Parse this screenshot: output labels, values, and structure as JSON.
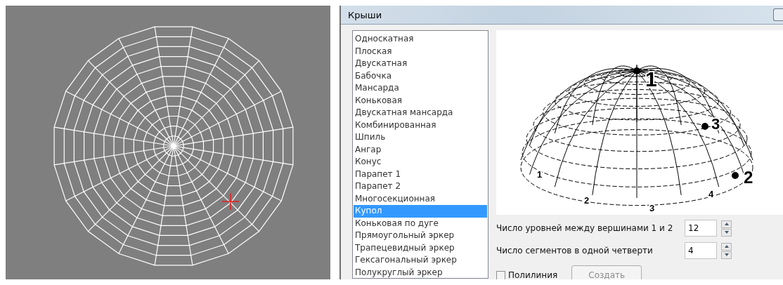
{
  "dialog": {
    "title": "Крыши"
  },
  "roof_types": [
    {
      "label": "Односкатная",
      "selected": false
    },
    {
      "label": "Плоская",
      "selected": false
    },
    {
      "label": "Двускатная",
      "selected": false
    },
    {
      "label": "Бабочка",
      "selected": false
    },
    {
      "label": "Мансарда",
      "selected": false
    },
    {
      "label": "Коньковая",
      "selected": false
    },
    {
      "label": "Двускатная мансарда",
      "selected": false
    },
    {
      "label": "Комбинированная",
      "selected": false
    },
    {
      "label": "Шпиль",
      "selected": false
    },
    {
      "label": "Ангар",
      "selected": false
    },
    {
      "label": "Конус",
      "selected": false
    },
    {
      "label": "Парапет 1",
      "selected": false
    },
    {
      "label": "Парапет 2",
      "selected": false
    },
    {
      "label": "Многосекционная",
      "selected": false
    },
    {
      "label": "Купол",
      "selected": true
    },
    {
      "label": "Коньковая по дуге",
      "selected": false
    },
    {
      "label": "Прямоугольный эркер",
      "selected": false
    },
    {
      "label": "Трапецевидный эркер",
      "selected": false
    },
    {
      "label": "Гексагональный эркер",
      "selected": false
    },
    {
      "label": "Полукруглый эркер",
      "selected": false
    }
  ],
  "preview": {
    "vertex_labels": [
      "1",
      "2",
      "3"
    ],
    "segment_labels": [
      "1",
      "2",
      "3",
      "4"
    ]
  },
  "parameters": [
    {
      "label": "Число уровней между вершинами 1 и 2",
      "value": "12"
    },
    {
      "label": "Число сегментов в одной четверти",
      "value": "4"
    }
  ],
  "polyline": {
    "label": "Полилиния",
    "checked": false
  },
  "create_button": {
    "label": "Создать",
    "disabled": true
  }
}
